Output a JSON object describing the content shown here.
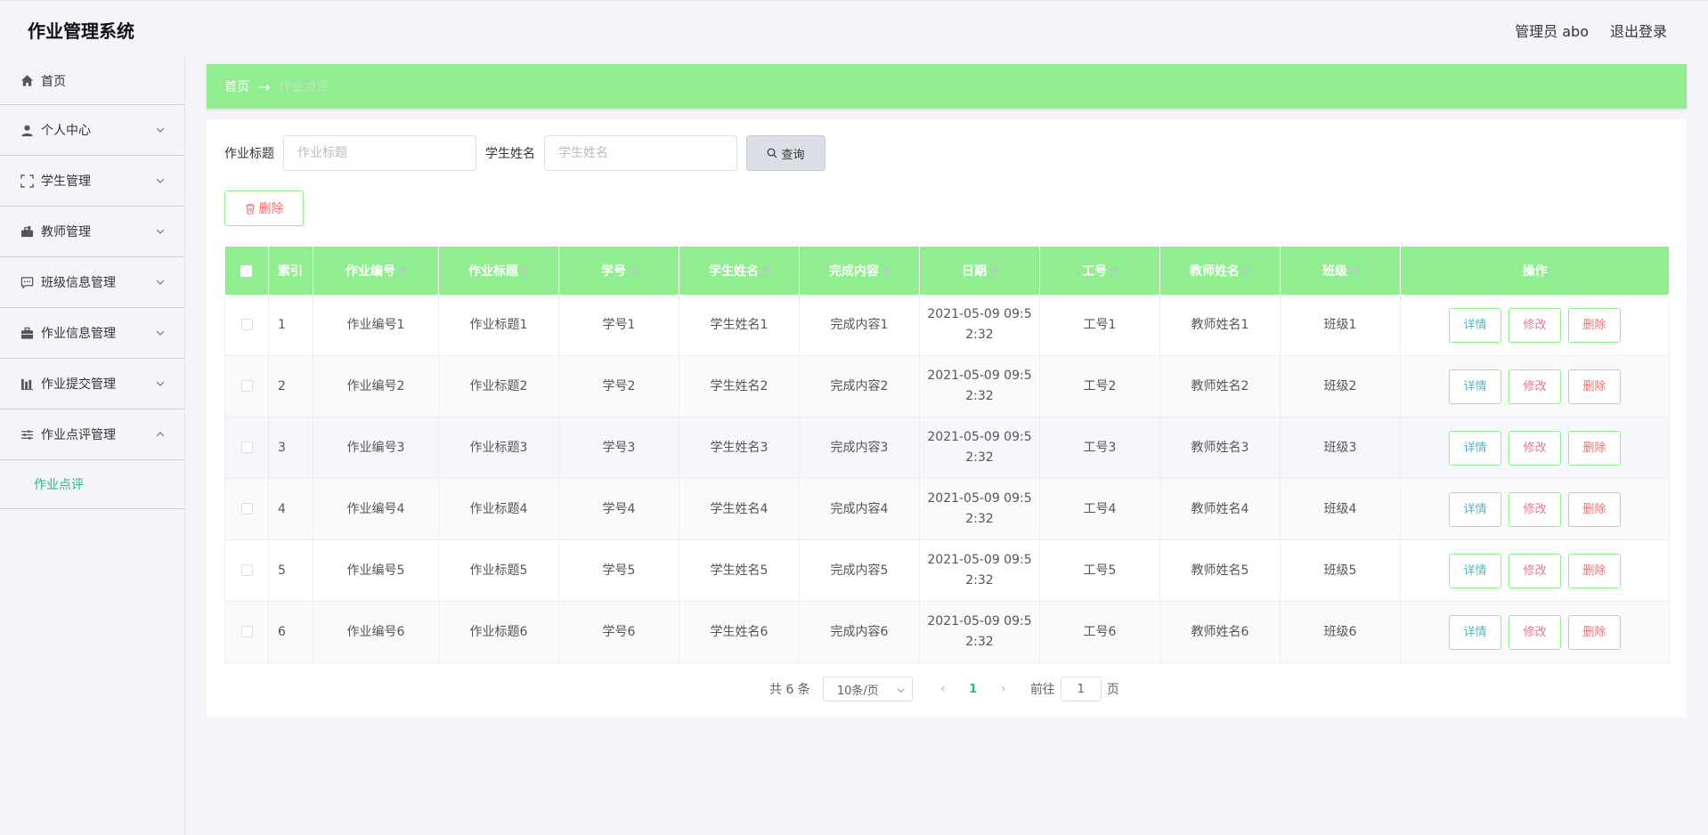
{
  "app": {
    "title": "作业管理系统"
  },
  "header": {
    "user_label": "管理员 abo",
    "logout_label": "退出登录"
  },
  "sidebar": {
    "items": [
      {
        "label": "首页",
        "icon": "home-icon"
      },
      {
        "label": "个人中心",
        "icon": "user-icon"
      },
      {
        "label": "学生管理",
        "icon": "scan-icon"
      },
      {
        "label": "教师管理",
        "icon": "toolbox-icon"
      },
      {
        "label": "班级信息管理",
        "icon": "chat-icon"
      },
      {
        "label": "作业信息管理",
        "icon": "briefcase-icon"
      },
      {
        "label": "作业提交管理",
        "icon": "bar-chart-icon"
      },
      {
        "label": "作业点评管理",
        "icon": "sliders-icon"
      }
    ],
    "submenu": {
      "label": "作业点评"
    }
  },
  "breadcrumb": {
    "home": "首页",
    "separator": "→",
    "current": "作业点评"
  },
  "search": {
    "title_label": "作业标题",
    "title_placeholder": "作业标题",
    "name_label": "学生姓名",
    "name_placeholder": "学生姓名",
    "query_label": "查询"
  },
  "toolbar": {
    "delete_label": "删除"
  },
  "table": {
    "headers": [
      "索引",
      "作业编号",
      "作业标题",
      "学号",
      "学生姓名",
      "完成内容",
      "日期",
      "工号",
      "教师姓名",
      "班级",
      "操作"
    ],
    "rows": [
      {
        "index": "1",
        "code": "作业编号1",
        "title": "作业标题1",
        "sid": "学号1",
        "sname": "学生姓名1",
        "content": "完成内容1",
        "date": "2021-05-09 09:52:32",
        "tid": "工号1",
        "tname": "教师姓名1",
        "cls": "班级1"
      },
      {
        "index": "2",
        "code": "作业编号2",
        "title": "作业标题2",
        "sid": "学号2",
        "sname": "学生姓名2",
        "content": "完成内容2",
        "date": "2021-05-09 09:52:32",
        "tid": "工号2",
        "tname": "教师姓名2",
        "cls": "班级2"
      },
      {
        "index": "3",
        "code": "作业编号3",
        "title": "作业标题3",
        "sid": "学号3",
        "sname": "学生姓名3",
        "content": "完成内容3",
        "date": "2021-05-09 09:52:32",
        "tid": "工号3",
        "tname": "教师姓名3",
        "cls": "班级3"
      },
      {
        "index": "4",
        "code": "作业编号4",
        "title": "作业标题4",
        "sid": "学号4",
        "sname": "学生姓名4",
        "content": "完成内容4",
        "date": "2021-05-09 09:52:32",
        "tid": "工号4",
        "tname": "教师姓名4",
        "cls": "班级4"
      },
      {
        "index": "5",
        "code": "作业编号5",
        "title": "作业标题5",
        "sid": "学号5",
        "sname": "学生姓名5",
        "content": "完成内容5",
        "date": "2021-05-09 09:52:32",
        "tid": "工号5",
        "tname": "教师姓名5",
        "cls": "班级5"
      },
      {
        "index": "6",
        "code": "作业编号6",
        "title": "作业标题6",
        "sid": "学号6",
        "sname": "学生姓名6",
        "content": "完成内容6",
        "date": "2021-05-09 09:52:32",
        "tid": "工号6",
        "tname": "教师姓名6",
        "cls": "班级6"
      }
    ],
    "actions": {
      "detail": "详情",
      "edit": "修改",
      "delete": "删除"
    }
  },
  "pagination": {
    "total_label": "共 6 条",
    "page_size": "10条/页",
    "current_page": "1",
    "goto_label": "前往",
    "goto_value": "1",
    "page_suffix": "页"
  },
  "colors": {
    "accent_green": "#90ee90",
    "link_teal": "#2db388",
    "danger": "#f56c6c"
  }
}
